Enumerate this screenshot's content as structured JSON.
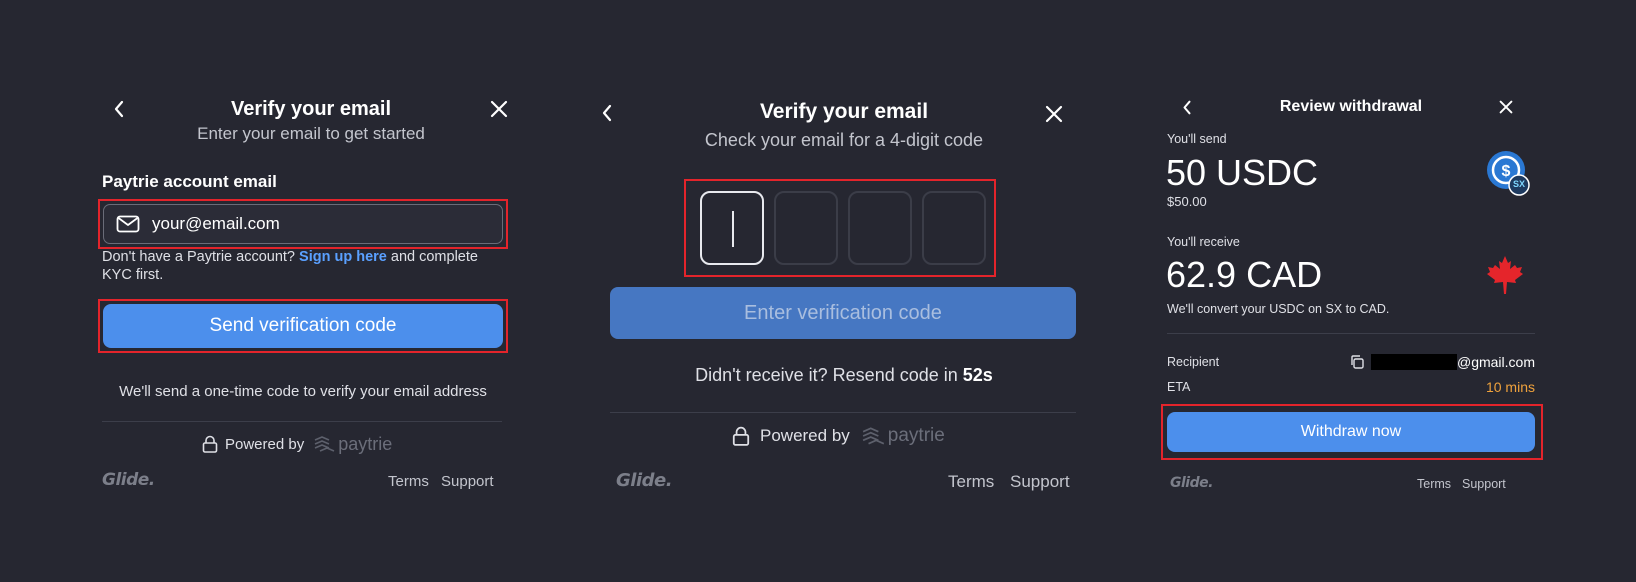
{
  "panel1": {
    "title": "Verify your email",
    "subtitle": "Enter your email to get started",
    "field_label": "Paytrie account email",
    "email_placeholder": "your@email.com",
    "help_pre": "Don't have a Paytrie account?",
    "help_link": "Sign up here",
    "help_post": "and complete KYC first.",
    "send_button": "Send verification code",
    "note": "We'll send a one-time code to verify your email address",
    "powered_by": "Powered by",
    "brand": "paytrie",
    "logo": "Glide.",
    "terms": "Terms",
    "support": "Support"
  },
  "panel2": {
    "title": "Verify your email",
    "subtitle": "Check your email for a 4-digit code",
    "code_button": "Enter verification code",
    "resend_text": "Didn't receive it? Resend code in",
    "resend_timer": "52s",
    "powered_by": "Powered by",
    "brand": "paytrie",
    "logo": "Glide.",
    "terms": "Terms",
    "support": "Support"
  },
  "panel3": {
    "title": "Review withdrawal",
    "send_label": "You'll send",
    "send_amount": "50 USDC",
    "send_fiat": "$50.00",
    "receive_label": "You'll receive",
    "receive_amount": "62.9 CAD",
    "convert_note": "We'll convert your USDC on SX to CAD.",
    "recipient_label": "Recipient",
    "recipient_value": "@gmail.com",
    "eta_label": "ETA",
    "eta_value": "10 mins",
    "withdraw_button": "Withdraw now",
    "logo": "Glide.",
    "terms": "Terms",
    "support": "Support",
    "badge_text": "SX"
  },
  "colors": {
    "background": "#262731",
    "accent_blue": "#4c8fec",
    "link_blue": "#5aa0ff",
    "eta_orange": "#f0a23c",
    "highlight_red": "#e3242b",
    "maple_red": "#e5252b"
  }
}
